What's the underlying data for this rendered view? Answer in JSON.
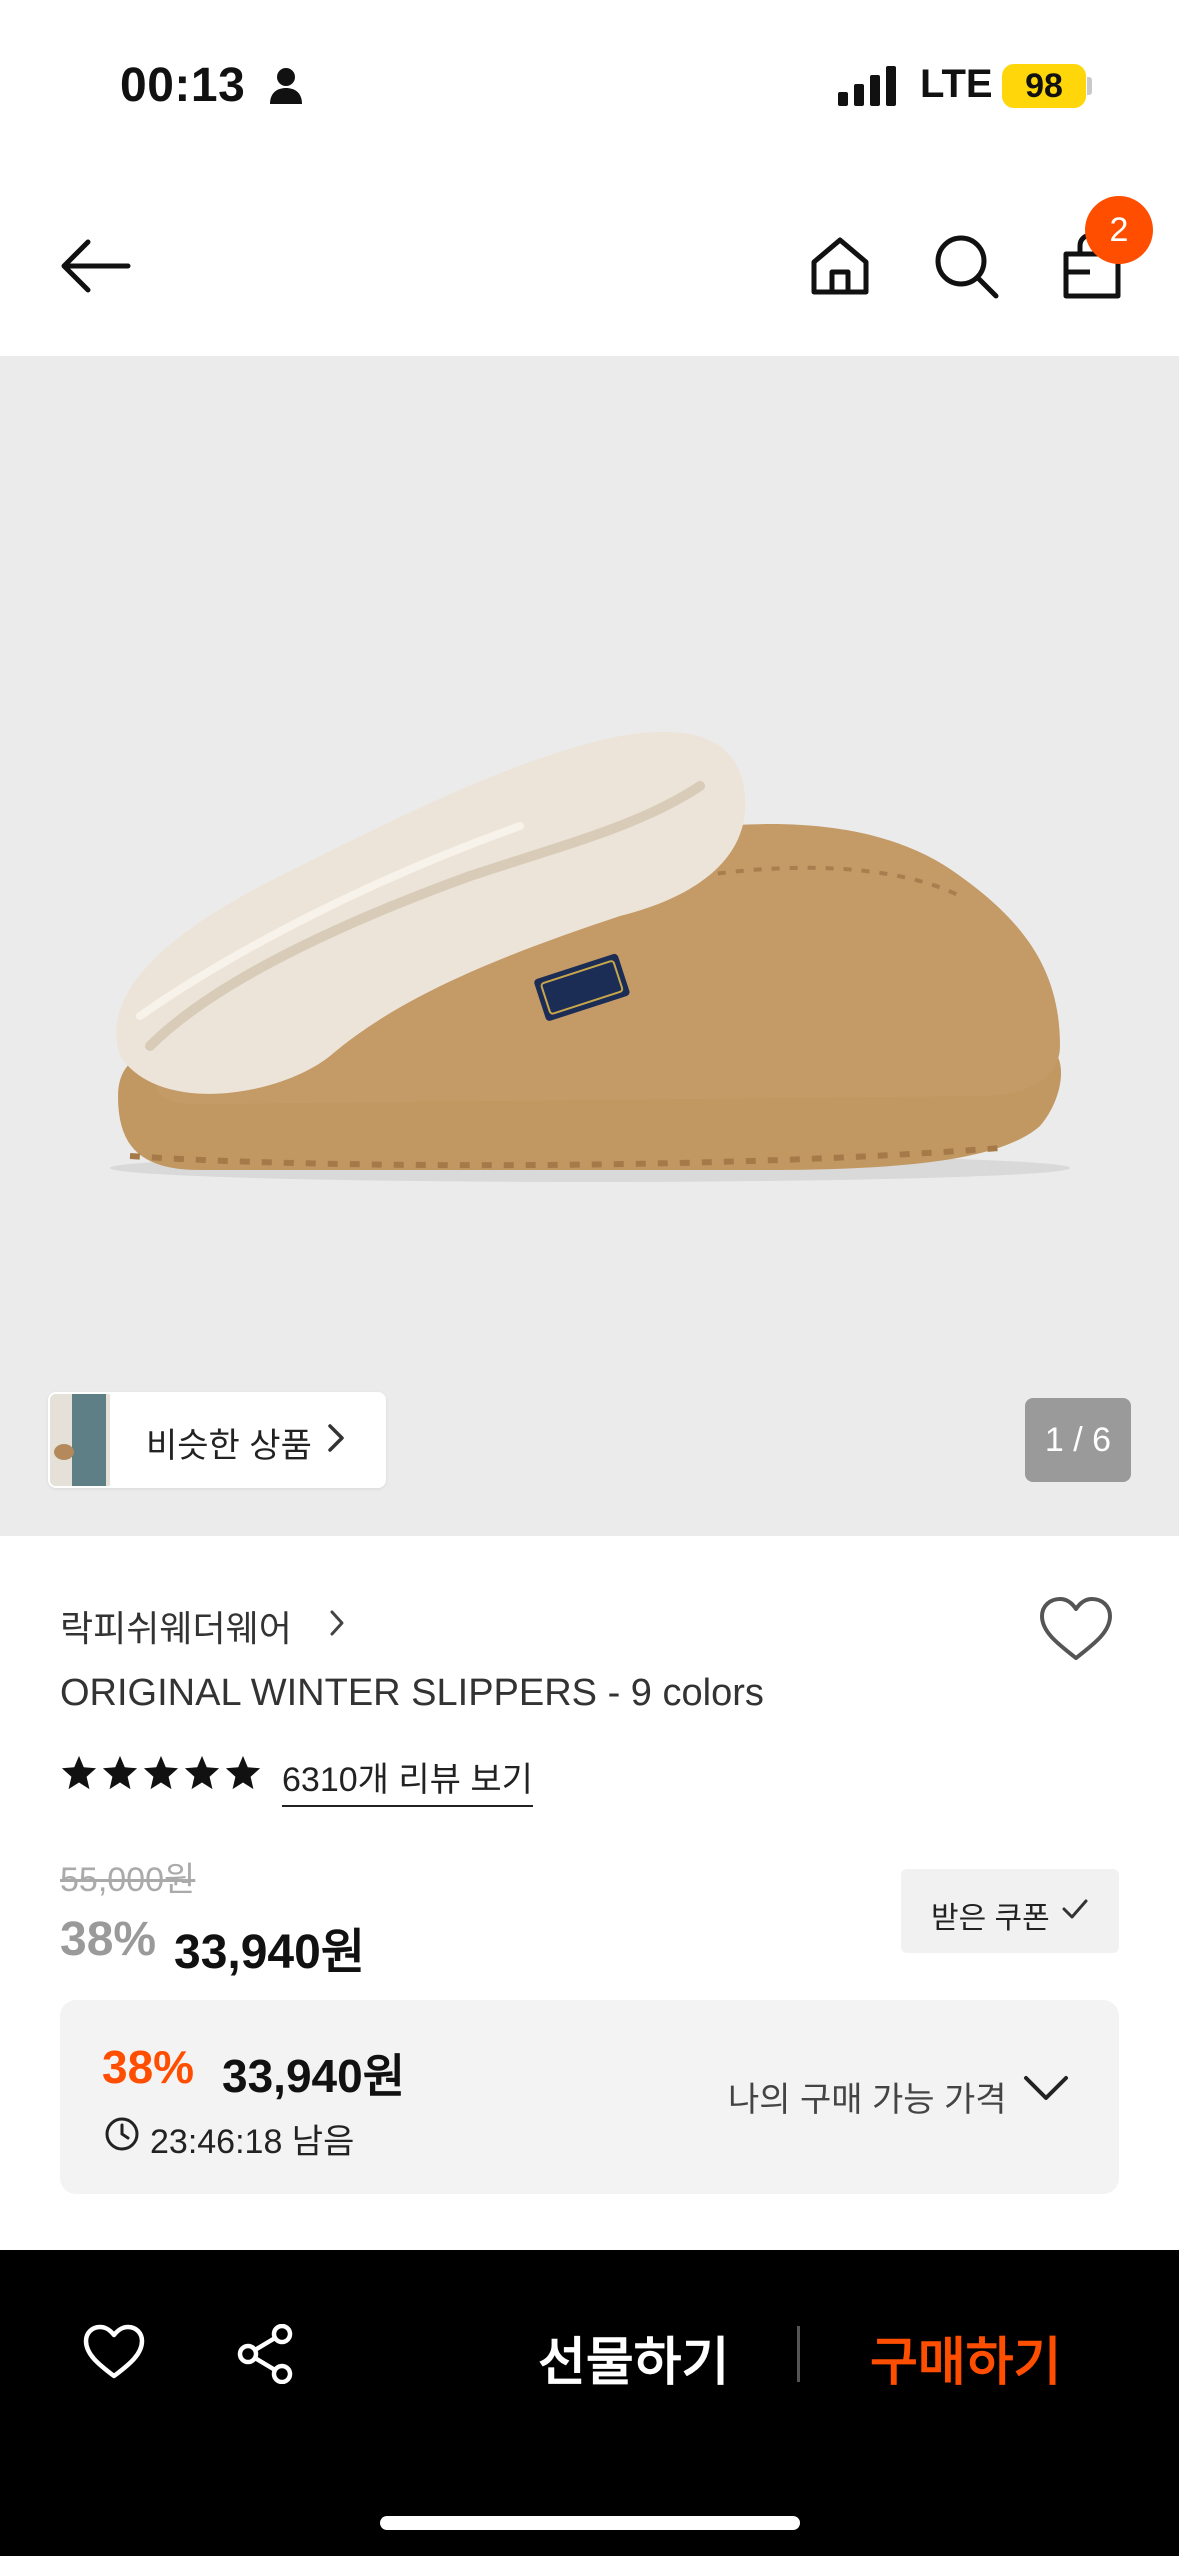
{
  "status_bar": {
    "time": "00:13",
    "network": "LTE",
    "battery": "98"
  },
  "nav": {
    "cart_count": "2"
  },
  "gallery": {
    "similar_label": "비슷한 상품",
    "pager": "1 / 6"
  },
  "product": {
    "brand": "락피쉬웨더웨어",
    "title": "ORIGINAL WINTER SLIPPERS - 9 colors",
    "rating_stars": 5,
    "review_link": "6310개 리뷰 보기",
    "original_price": "55,000원",
    "discount": "38%",
    "price": "33,940원",
    "coupon_label": "받은 쿠폰"
  },
  "my_price": {
    "discount": "38%",
    "price": "33,940원",
    "timer": "23:46:18 남음",
    "label": "나의 구매 가능 가격"
  },
  "bottom_bar": {
    "gift_label": "선물하기",
    "buy_label": "구매하기"
  },
  "colors": {
    "accent": "#ff4e00",
    "battery": "#ffd60a"
  }
}
